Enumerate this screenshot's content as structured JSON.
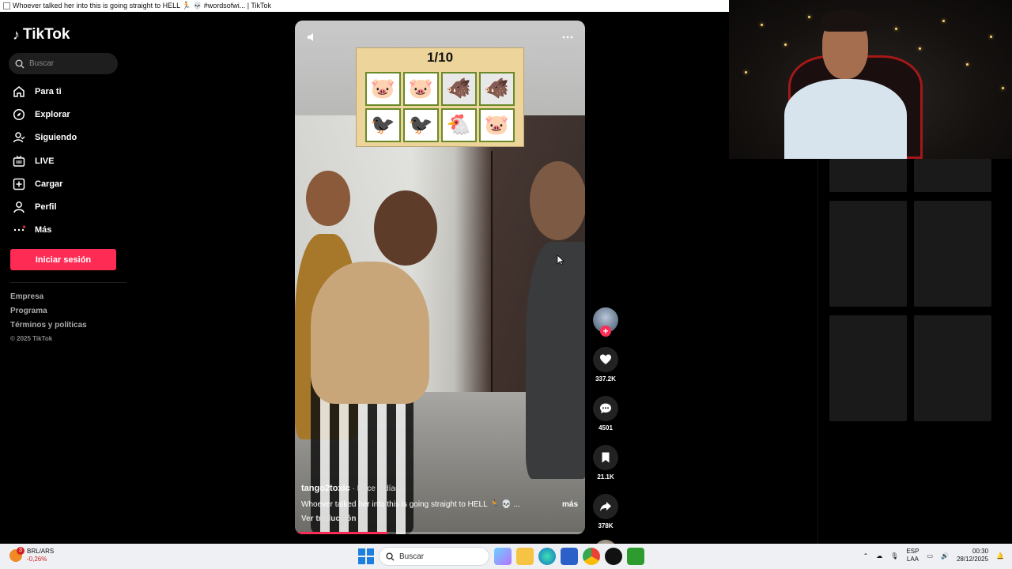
{
  "window": {
    "title": "Whoever talked her into this is going straight to HELL 🏃 💀 #wordsofwi... | TikTok"
  },
  "sidebar": {
    "logo": "TikTok",
    "search_placeholder": "Buscar",
    "nav": [
      {
        "label": "Para ti",
        "icon": "home-icon"
      },
      {
        "label": "Explorar",
        "icon": "compass-icon"
      },
      {
        "label": "Siguiendo",
        "icon": "following-icon"
      },
      {
        "label": "LIVE",
        "icon": "live-icon"
      },
      {
        "label": "Cargar",
        "icon": "upload-icon"
      },
      {
        "label": "Perfil",
        "icon": "profile-icon"
      },
      {
        "label": "Más",
        "icon": "more-icon"
      }
    ],
    "login_label": "Iniciar sesión",
    "footer": [
      "Empresa",
      "Programa",
      "Términos y políticas"
    ],
    "copyright": "© 2025 TikTok"
  },
  "video": {
    "game_counter": "1/10",
    "tiles": [
      "🐷",
      "🐷",
      "🐗",
      "🐗",
      "🐦‍⬛",
      "🐦‍⬛",
      "🐔",
      "🐷"
    ],
    "username": "tango2toxic",
    "posted": "· Hace 4 día(s)",
    "description": "Whoever talked her into this is going straight to HELL 🏃 💀 ...",
    "more_label": "más",
    "translate_label": "Ver traducción",
    "progress": 0.32
  },
  "actions": {
    "likes": "337.2K",
    "comments": "4501",
    "saves": "21.1K",
    "shares": "378K"
  },
  "taskbar": {
    "ticker_badge": "3",
    "ticker_pair": "BRL/ARS",
    "ticker_change": "-0,26%",
    "search_label": "Buscar",
    "lang_top": "ESP",
    "lang_bottom": "LAA",
    "time": "00:30",
    "date": "28/12/2025"
  },
  "colors": {
    "accent": "#fe2c55",
    "background": "#000000"
  }
}
